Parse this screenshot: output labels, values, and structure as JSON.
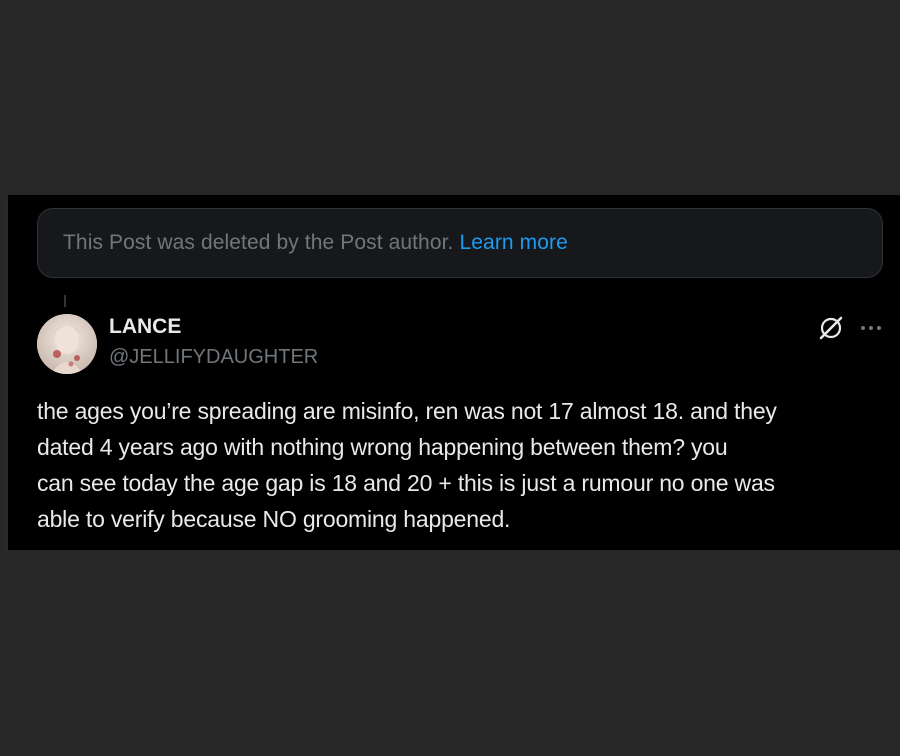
{
  "deleted_notice": {
    "text": "This Post was deleted by the Post author.",
    "link": "Learn more"
  },
  "post": {
    "author_name": "LANCE",
    "author_handle": "@JELLIFYDAUGHTER",
    "text": "the ages you’re spreading are misinfo, ren was not 17 almost 18. and they\ndated 4 years ago with nothing wrong happening between them? you\ncan see today the age gap is 18 and 20 + this is just a rumour no one was\nable to verify because NO grooming happened."
  },
  "icons": {
    "grok": "grok-icon",
    "more": "more-options-icon"
  },
  "colors": {
    "background": "#000000",
    "page_border": "#282828",
    "text_primary": "#e7e9ea",
    "text_secondary": "#71767b",
    "link": "#1d9bf0"
  }
}
